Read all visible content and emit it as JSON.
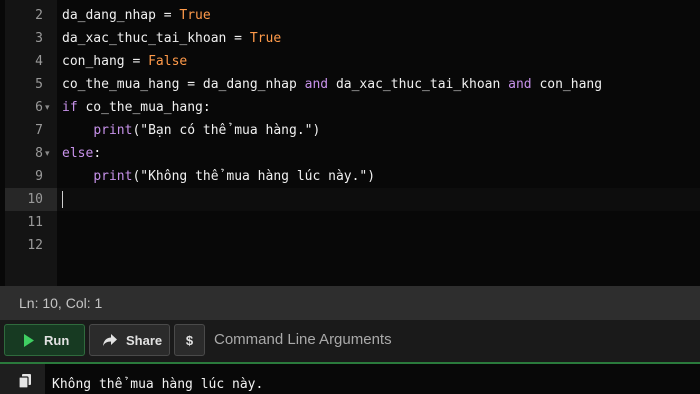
{
  "editor": {
    "line_numbers": [
      "2",
      "3",
      "4",
      "5",
      "6",
      "7",
      "8",
      "9",
      "10",
      "11",
      "12"
    ],
    "lines": [
      [
        {
          "t": "da_dang_nhap = ",
          "c": ""
        },
        {
          "t": "True",
          "c": "tok-const"
        }
      ],
      [
        {
          "t": "da_xac_thuc_tai_khoan = ",
          "c": ""
        },
        {
          "t": "True",
          "c": "tok-const"
        }
      ],
      [
        {
          "t": "con_hang = ",
          "c": ""
        },
        {
          "t": "False",
          "c": "tok-const"
        }
      ],
      [
        {
          "t": "co_the_mua_hang = da_dang_nhap ",
          "c": ""
        },
        {
          "t": "and",
          "c": "tok-kw"
        },
        {
          "t": " da_xac_thuc_tai_khoan ",
          "c": ""
        },
        {
          "t": "and",
          "c": "tok-kw"
        },
        {
          "t": " con_hang",
          "c": ""
        }
      ],
      [
        {
          "t": "if",
          "c": "tok-kw"
        },
        {
          "t": " co_the_mua_hang:",
          "c": ""
        }
      ],
      [
        {
          "t": "    ",
          "c": ""
        },
        {
          "t": "print",
          "c": "tok-fn"
        },
        {
          "t": "(\"Bạn có thể mua hàng.\")",
          "c": "tok-str"
        }
      ],
      [
        {
          "t": "else",
          "c": "tok-kw"
        },
        {
          "t": ":",
          "c": ""
        }
      ],
      [
        {
          "t": "    ",
          "c": ""
        },
        {
          "t": "print",
          "c": "tok-fn"
        },
        {
          "t": "(\"Không thể mua hàng lúc này.\")",
          "c": "tok-str"
        }
      ],
      [],
      [],
      []
    ],
    "fold_marker": "▾"
  },
  "status": {
    "position": "Ln: 10,  Col: 1"
  },
  "toolbar": {
    "run_label": "Run",
    "share_label": "Share",
    "args_button_label": "$",
    "args_placeholder": "Command Line Arguments"
  },
  "output": {
    "text": "Không thể mua hàng lúc này."
  },
  "colors": {
    "accent": "#2a7a3c",
    "keyword": "#c792ea",
    "constant": "#ff9a4a"
  }
}
